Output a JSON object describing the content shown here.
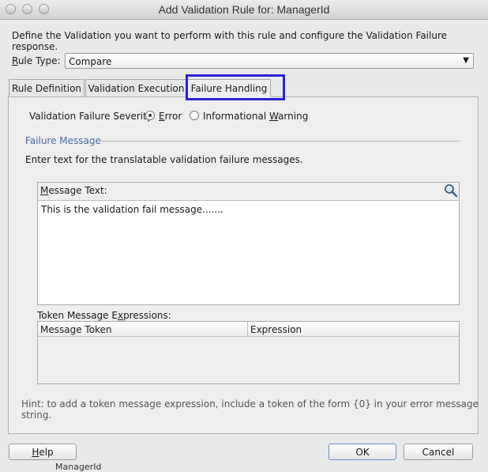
{
  "window": {
    "title": "Add Validation Rule for: ManagerId"
  },
  "intro_text": "Define the Validation you want to perform with this rule and configure the Validation Failure response.",
  "rule_type": {
    "label_first": "R",
    "label_rest": "ule Type:",
    "value": "Compare"
  },
  "tabs": [
    {
      "label": "Rule Definition"
    },
    {
      "label": "Validation Execution"
    },
    {
      "label": "Failure Handling"
    }
  ],
  "severity": {
    "label": "Validation Failure Severity",
    "option1_first": "E",
    "option1_rest": "rror",
    "option2_pre": "Informational ",
    "option2_mnemonic": "W",
    "option2_rest": "arning",
    "selected": "Error"
  },
  "failure_message": {
    "section_title": "Failure Message",
    "instructions": "Enter text for the translatable validation failure messages.",
    "header_first": "M",
    "header_rest": "essage Text:",
    "text": "This is the validation fail message......."
  },
  "token_table": {
    "label_pre": "Token Message E",
    "label_mnemonic": "x",
    "label_rest": "pressions:",
    "columns": [
      "Message Token",
      "Expression"
    ]
  },
  "hint": "Hint: to add a token message expression, include a token of the form {0} in your error message string.",
  "buttons": {
    "help_first": "H",
    "help_rest": "elp",
    "ok": "OK",
    "cancel": "Cancel"
  },
  "background_peek": "ManagerId",
  "colors": {
    "highlight": "#2a23d6",
    "section_title": "#4a6aa8"
  }
}
